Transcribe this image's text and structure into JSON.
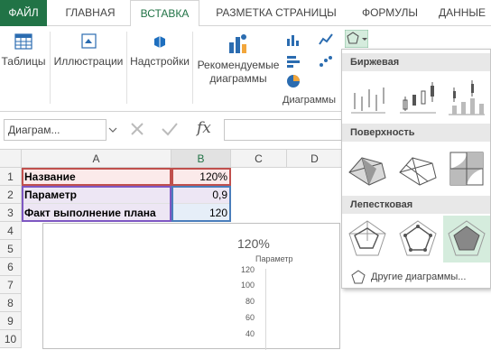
{
  "tabs": [
    "ФАЙЛ",
    "ГЛАВНАЯ",
    "ВСТАВКА",
    "РАЗМЕТКА СТРАНИЦЫ",
    "ФОРМУЛЫ",
    "ДАННЫЕ"
  ],
  "ribbon": {
    "tables": "Таблицы",
    "illustrations": "Иллюстрации",
    "addins": "Надстройки",
    "recommended1": "Рекомендуемые",
    "recommended2": "диаграммы",
    "charts_group": "Диаграммы"
  },
  "formula_bar": {
    "name_box": "Диаграм...",
    "fx": "fx"
  },
  "columns": [
    "A",
    "B",
    "C",
    "D"
  ],
  "rows": [
    "1",
    "2",
    "3",
    "4",
    "5",
    "6",
    "7",
    "8",
    "9",
    "10"
  ],
  "cells": [
    {
      "label": "Название",
      "value": "120%"
    },
    {
      "label": "Параметр",
      "value": "0,9"
    },
    {
      "label": "Факт выполнение плана",
      "value": "120"
    }
  ],
  "chart": {
    "title": "120%",
    "series_label": "Параметр",
    "y_ticks": [
      "120",
      "100",
      "80",
      "60",
      "40"
    ]
  },
  "dropdown": {
    "stock": "Биржевая",
    "surface": "Поверхность",
    "radar": "Лепестковая",
    "more": "Другие диаграммы..."
  },
  "colors": {
    "accent": "#217346",
    "selection": "#d5ecdd"
  }
}
